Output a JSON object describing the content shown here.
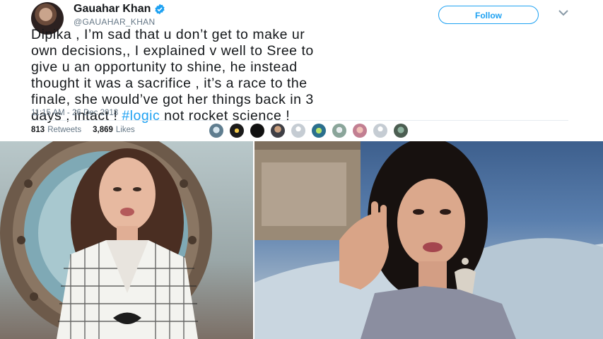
{
  "tweet": {
    "name": "Gauahar Khan",
    "handle": "@GAUAHAR_KHAN",
    "follow_label": "Follow",
    "text_lines": [
      "Dipika , I’m sad that u don’t get to make ur",
      "own decisions,, I explained v well to Sree to",
      "give u an opportunity to shine, he instead",
      "thought it was a sacrifice , it’s a race to the",
      "finale, she would’ve got her things back in 3",
      "days , intact ! "
    ],
    "hashtag": "#logic",
    "text_tail": " not rocket science !",
    "timestamp": "11:15 AM - 26 Dec 2018",
    "retweets_count": "813",
    "retweets_label": "Retweets",
    "likes_count": "3,869",
    "likes_label": "Likes",
    "likers_count": 10
  },
  "colors": {
    "accent": "#1da1f2",
    "text": "#14171a",
    "muted": "#657786"
  }
}
